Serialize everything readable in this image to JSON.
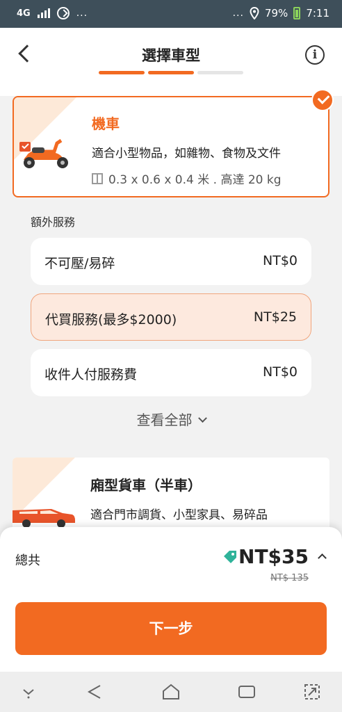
{
  "status_bar": {
    "network": "4G",
    "battery": "79%",
    "time": "7:11",
    "more_left": "...",
    "more_right": "...",
    "icons": [
      "signal-icon",
      "dnd-icon",
      "location-icon",
      "battery-icon"
    ]
  },
  "header": {
    "title": "選擇車型",
    "progress": {
      "total_steps": 3,
      "completed_steps": 2
    },
    "icons": [
      "back-icon",
      "info-icon"
    ],
    "info_glyph": "i"
  },
  "selected_vehicle": {
    "name": "機車",
    "description": "適合小型物品，如雜物、食物及文件",
    "spec": "0.3 x 0.6 x 0.4 米 . 高達 20 kg",
    "selected": true
  },
  "extra_services": {
    "label": "額外服務",
    "items": [
      {
        "name": "不可壓/易碎",
        "price": "NT$0",
        "selected": false
      },
      {
        "name": "代買服務(最多$2000)",
        "price": "NT$25",
        "selected": true
      },
      {
        "name": "收件人付服務費",
        "price": "NT$0",
        "selected": false
      }
    ],
    "view_all": "查看全部"
  },
  "next_vehicle": {
    "name": "廂型貨車（半車）",
    "description": "適合門市調貨、小型家具、易碎品"
  },
  "summary": {
    "total_label": "總共",
    "price": "NT$35",
    "original_price": "NT$ 135",
    "next_button": "下一步"
  },
  "colors": {
    "accent": "#f26a21",
    "accent_light": "#fde9de",
    "status_bar": "#3e4f5a",
    "tag": "#2fb39a",
    "progress_inactive": "#e5e5e5"
  }
}
